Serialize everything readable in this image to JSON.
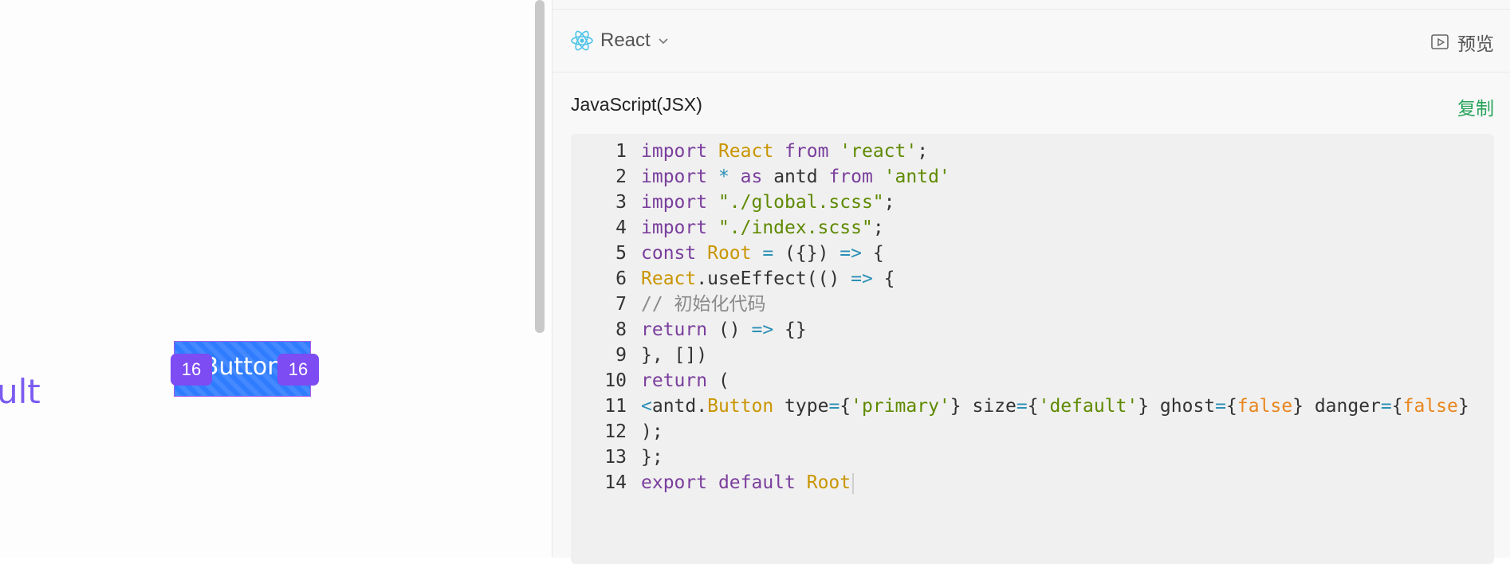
{
  "canvas": {
    "partial_label": "ult",
    "selected_button_text": "Button",
    "spacing_left": "16",
    "spacing_right": "16"
  },
  "panel": {
    "framework": "React",
    "preview_label": "预览",
    "code_language": "JavaScript(JSX)",
    "copy_label": "复制",
    "lines": [
      {
        "n": "1",
        "tokens": [
          [
            "kw",
            "import "
          ],
          [
            "cls",
            "React "
          ],
          [
            "kw",
            "from "
          ],
          [
            "str",
            "'react'"
          ],
          [
            "id",
            ";"
          ]
        ]
      },
      {
        "n": "2",
        "tokens": [
          [
            "kw",
            "import "
          ],
          [
            "op",
            "* "
          ],
          [
            "kw",
            "as "
          ],
          [
            "id",
            "antd "
          ],
          [
            "kw",
            "from "
          ],
          [
            "str",
            "'antd'"
          ]
        ]
      },
      {
        "n": "3",
        "tokens": [
          [
            "kw",
            "import "
          ],
          [
            "str",
            "\"./global.scss\""
          ],
          [
            "id",
            ";"
          ]
        ]
      },
      {
        "n": "4",
        "tokens": [
          [
            "kw",
            "import "
          ],
          [
            "str",
            "\"./index.scss\""
          ],
          [
            "id",
            ";"
          ]
        ]
      },
      {
        "n": "5",
        "tokens": [
          [
            "kw",
            "const "
          ],
          [
            "cls",
            "Root "
          ],
          [
            "op",
            "= "
          ],
          [
            "id",
            "({}) "
          ],
          [
            "op",
            "=> "
          ],
          [
            "id",
            "{"
          ]
        ]
      },
      {
        "n": "6",
        "tokens": [
          [
            "cls",
            "React"
          ],
          [
            "id",
            ".useEffect(() "
          ],
          [
            "op",
            "=> "
          ],
          [
            "id",
            "{"
          ]
        ]
      },
      {
        "n": "7",
        "tokens": [
          [
            "cmt",
            "// 初始化代码"
          ]
        ]
      },
      {
        "n": "8",
        "tokens": [
          [
            "kw",
            "return "
          ],
          [
            "id",
            "() "
          ],
          [
            "op",
            "=> "
          ],
          [
            "id",
            "{}"
          ]
        ]
      },
      {
        "n": "9",
        "tokens": [
          [
            "id",
            "}, [])"
          ]
        ]
      },
      {
        "n": "10",
        "tokens": [
          [
            "kw",
            "return "
          ],
          [
            "id",
            "("
          ]
        ]
      },
      {
        "n": "11",
        "tokens": [
          [
            "op",
            "<"
          ],
          [
            "id",
            "antd."
          ],
          [
            "cls",
            "Button "
          ],
          [
            "id",
            "type"
          ],
          [
            "op",
            "="
          ],
          [
            "id",
            "{"
          ],
          [
            "str",
            "'primary'"
          ],
          [
            "id",
            "} size"
          ],
          [
            "op",
            "="
          ],
          [
            "id",
            "{"
          ],
          [
            "str",
            "'default'"
          ],
          [
            "id",
            "} ghost"
          ],
          [
            "op",
            "="
          ],
          [
            "id",
            "{"
          ],
          [
            "bool",
            "false"
          ],
          [
            "id",
            "} danger"
          ],
          [
            "op",
            "="
          ],
          [
            "id",
            "{"
          ],
          [
            "bool",
            "false"
          ],
          [
            "id",
            "}"
          ]
        ]
      },
      {
        "n": "12",
        "tokens": [
          [
            "id",
            ");"
          ]
        ]
      },
      {
        "n": "13",
        "tokens": [
          [
            "id",
            "};"
          ]
        ]
      },
      {
        "n": "14",
        "tokens": [
          [
            "kw",
            "export "
          ],
          [
            "kw",
            "default "
          ],
          [
            "cls",
            "Root"
          ]
        ]
      }
    ]
  },
  "colors": {
    "accent_purple": "#7d4cf2",
    "primary_blue": "#2f7cff",
    "copy_green": "#27a35a"
  },
  "icons": {
    "framework": "react-icon",
    "preview": "preview-icon",
    "dropdown": "chevron-down-icon"
  }
}
